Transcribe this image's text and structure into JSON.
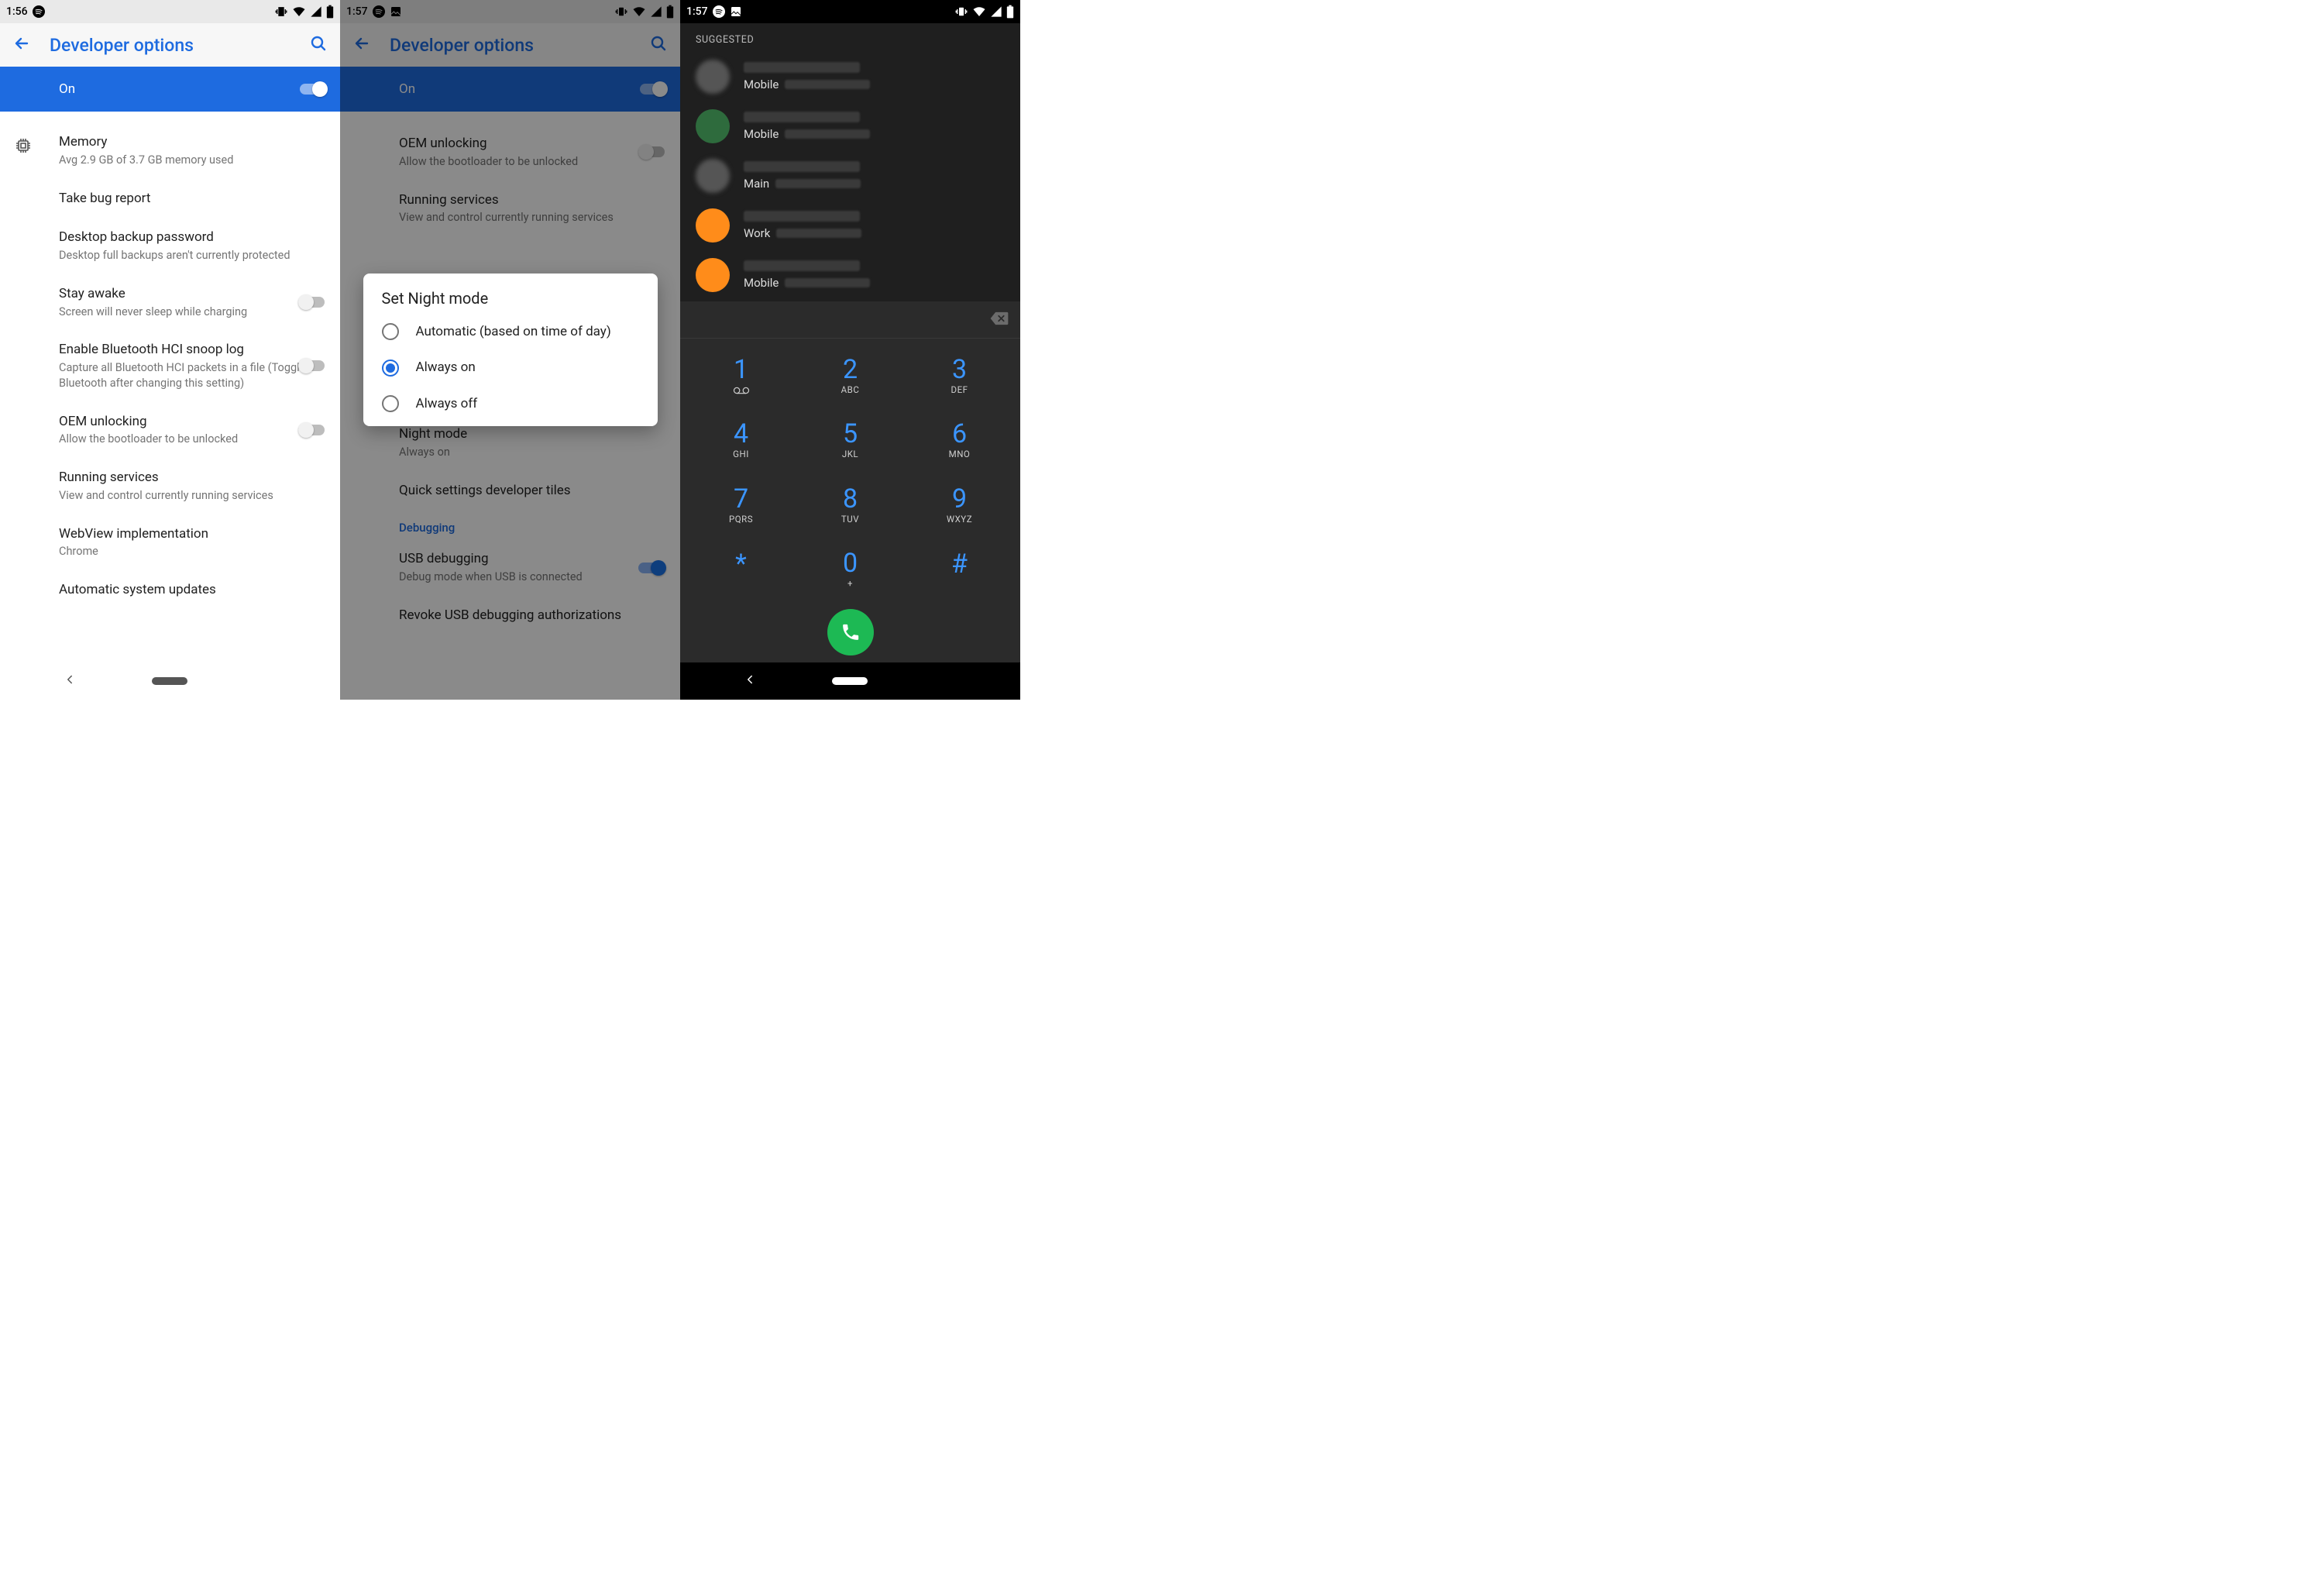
{
  "panel1": {
    "status_time": "1:56",
    "appbar_title": "Developer options",
    "master_label": "On",
    "items": [
      {
        "primary": "Memory",
        "secondary": "Avg 2.9 GB of 3.7 GB memory used",
        "icon": true
      },
      {
        "primary": "Take bug report"
      },
      {
        "primary": "Desktop backup password",
        "secondary": "Desktop full backups aren't currently protected"
      },
      {
        "primary": "Stay awake",
        "secondary": "Screen will never sleep while charging",
        "toggle": false
      },
      {
        "primary": "Enable Bluetooth HCI snoop log",
        "secondary": "Capture all Bluetooth HCI packets in a file (Toggle Bluetooth after changing this setting)",
        "toggle": false
      },
      {
        "primary": "OEM unlocking",
        "secondary": "Allow the bootloader to be unlocked",
        "toggle": false
      },
      {
        "primary": "Running services",
        "secondary": "View and control currently running services"
      },
      {
        "primary": "WebView implementation",
        "secondary": "Chrome"
      },
      {
        "primary": "Automatic system updates"
      }
    ]
  },
  "panel2": {
    "status_time": "1:57",
    "appbar_title": "Developer options",
    "master_label": "On",
    "bg_items": {
      "oem_primary": "OEM unlocking",
      "oem_secondary": "Allow the bootloader to be unlocked",
      "running_primary": "Running services",
      "running_secondary": "View and control currently running services",
      "night_primary": "Night mode",
      "night_secondary": "Always on",
      "quick_primary": "Quick settings developer tiles",
      "debug_section": "Debugging",
      "usb_primary": "USB debugging",
      "usb_secondary": "Debug mode when USB is connected",
      "revoke_primary": "Revoke USB debugging authorizations"
    },
    "dialog": {
      "title": "Set Night mode",
      "options": [
        "Automatic (based on time of day)",
        "Always on",
        "Always off"
      ],
      "selected": 1
    }
  },
  "panel3": {
    "status_time": "1:57",
    "suggested": "SUGGESTED",
    "contacts": [
      {
        "type": "Mobile",
        "avatar": "blur"
      },
      {
        "type": "Mobile",
        "avatar": "green"
      },
      {
        "type": "Main",
        "avatar": "blur"
      },
      {
        "type": "Work",
        "avatar": "orange"
      },
      {
        "type": "Mobile",
        "avatar": "orange"
      }
    ],
    "keys": [
      {
        "d": "1",
        "sub_icon": "voicemail"
      },
      {
        "d": "2",
        "l": "ABC"
      },
      {
        "d": "3",
        "l": "DEF"
      },
      {
        "d": "4",
        "l": "GHI"
      },
      {
        "d": "5",
        "l": "JKL"
      },
      {
        "d": "6",
        "l": "MNO"
      },
      {
        "d": "7",
        "l": "PQRS"
      },
      {
        "d": "8",
        "l": "TUV"
      },
      {
        "d": "9",
        "l": "WXYZ"
      },
      {
        "d": "*"
      },
      {
        "d": "0",
        "l": "+"
      },
      {
        "d": "#"
      }
    ]
  }
}
